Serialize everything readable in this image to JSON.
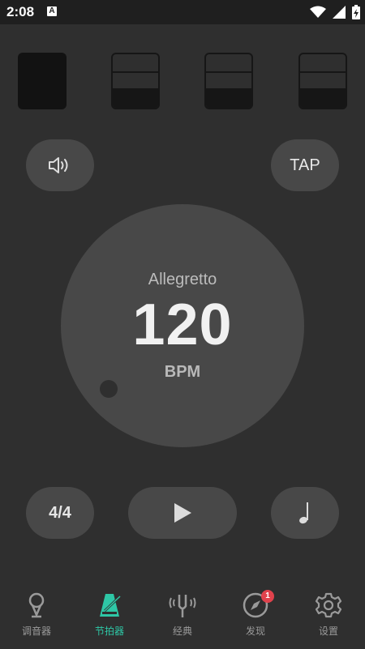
{
  "status_bar": {
    "time": "2:08",
    "notification_icon": "A"
  },
  "beats": [
    {
      "state": "active"
    },
    {
      "state": "medium"
    },
    {
      "state": "medium"
    },
    {
      "state": "medium"
    }
  ],
  "controls": {
    "sound_icon": "speaker-icon",
    "tap_label": "TAP"
  },
  "tempo": {
    "name": "Allegretto",
    "value": "120",
    "unit": "BPM"
  },
  "bottom_controls": {
    "time_signature": "4/4",
    "play_icon": "play-icon",
    "note_icon": "quarter-note-icon"
  },
  "nav": {
    "items": [
      {
        "label": "调音器",
        "icon": "tuner-pin-icon",
        "active": false
      },
      {
        "label": "节拍器",
        "icon": "metronome-icon",
        "active": true
      },
      {
        "label": "经典",
        "icon": "tuning-fork-icon",
        "active": false
      },
      {
        "label": "发现",
        "icon": "compass-icon",
        "active": false,
        "badge": "1"
      },
      {
        "label": "设置",
        "icon": "gear-icon",
        "active": false
      }
    ]
  },
  "colors": {
    "accent": "#2ec7a6",
    "badge": "#e0424c",
    "background": "#2f2f2f",
    "surface": "#484848"
  }
}
